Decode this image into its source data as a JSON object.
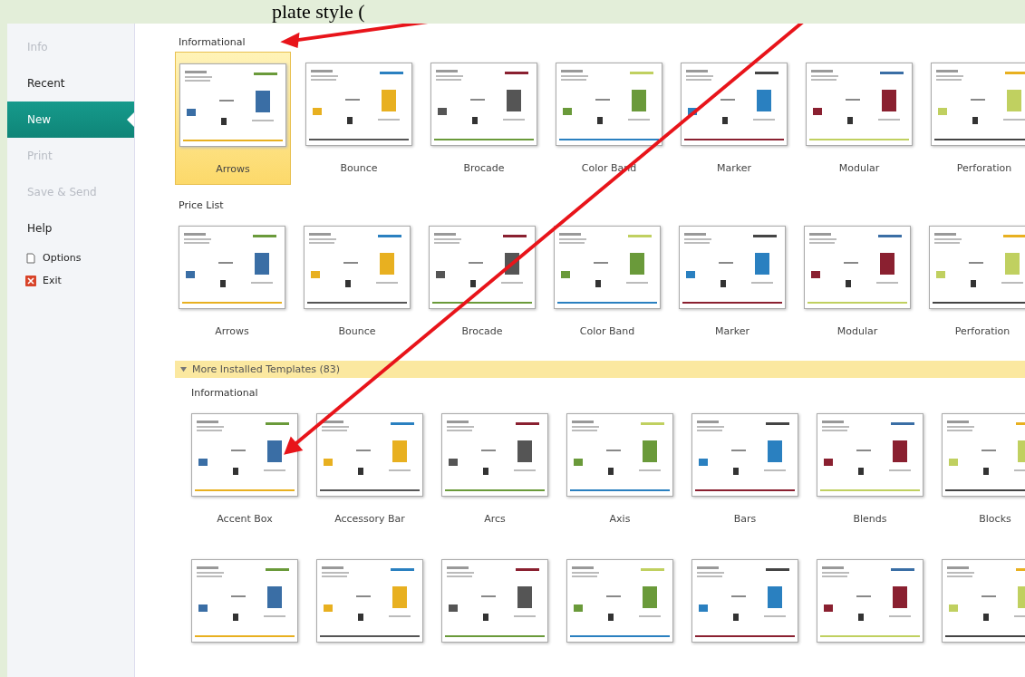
{
  "caption": "plate style (",
  "sidebar": {
    "items": [
      {
        "label": "Info",
        "kind": "tab",
        "selected": false,
        "disabled": true
      },
      {
        "label": "Recent",
        "kind": "tab",
        "selected": false,
        "disabled": false
      },
      {
        "label": "New",
        "kind": "tab",
        "selected": true,
        "disabled": false
      },
      {
        "label": "Print",
        "kind": "tab",
        "selected": false,
        "disabled": true
      },
      {
        "label": "Save & Send",
        "kind": "tab",
        "selected": false,
        "disabled": true
      },
      {
        "label": "Help",
        "kind": "tab",
        "selected": false,
        "disabled": false
      },
      {
        "label": "Options",
        "kind": "options",
        "disabled": false
      },
      {
        "label": "Exit",
        "kind": "exit",
        "disabled": false
      }
    ]
  },
  "sections": [
    {
      "heading": "Informational",
      "templates": [
        {
          "name": "Arrows",
          "selected": true
        },
        {
          "name": "Bounce",
          "selected": false
        },
        {
          "name": "Brocade",
          "selected": false
        },
        {
          "name": "Color Band",
          "selected": false
        },
        {
          "name": "Marker",
          "selected": false
        },
        {
          "name": "Modular",
          "selected": false
        },
        {
          "name": "Perforation",
          "selected": false
        }
      ]
    },
    {
      "heading": "Price List",
      "templates": [
        {
          "name": "Arrows",
          "selected": false
        },
        {
          "name": "Bounce",
          "selected": false
        },
        {
          "name": "Brocade",
          "selected": false
        },
        {
          "name": "Color Band",
          "selected": false
        },
        {
          "name": "Marker",
          "selected": false
        },
        {
          "name": "Modular",
          "selected": false
        },
        {
          "name": "Perforation",
          "selected": false
        }
      ]
    }
  ],
  "more_templates": {
    "title": "More Installed Templates (83)",
    "expanded": true,
    "sections": [
      {
        "heading": "Informational",
        "templates": [
          {
            "name": "Accent Box",
            "selected": false
          },
          {
            "name": "Accessory Bar",
            "selected": false
          },
          {
            "name": "Arcs",
            "selected": false
          },
          {
            "name": "Axis",
            "selected": false
          },
          {
            "name": "Bars",
            "selected": false
          },
          {
            "name": "Blends",
            "selected": false
          },
          {
            "name": "Blocks",
            "selected": false
          }
        ]
      },
      {
        "templates": [
          {
            "selected": false
          },
          {
            "selected": false
          },
          {
            "selected": false
          },
          {
            "selected": false
          },
          {
            "selected": false
          },
          {
            "selected": false
          },
          {
            "selected": false
          }
        ]
      }
    ]
  }
}
